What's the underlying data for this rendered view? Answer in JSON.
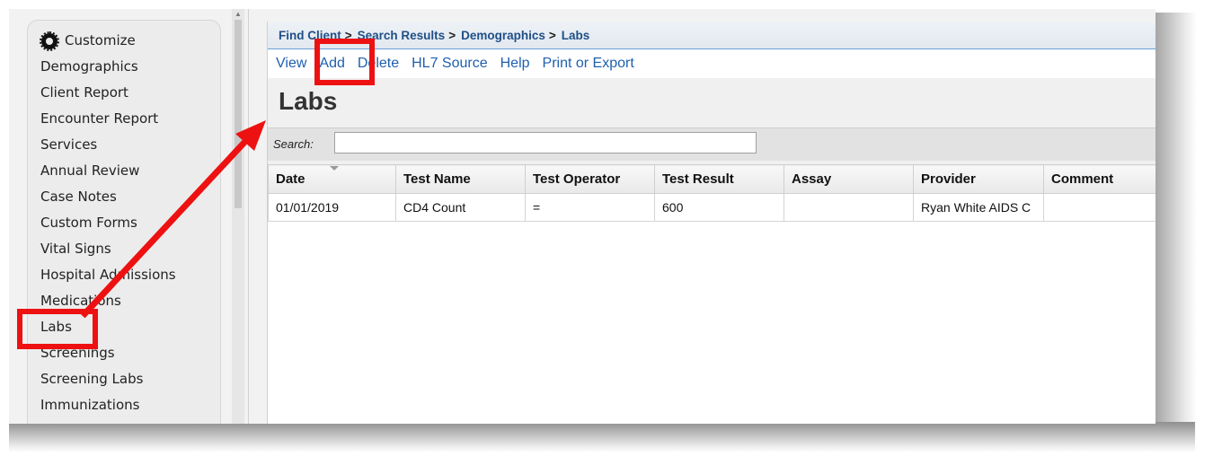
{
  "sidebar": {
    "items": [
      {
        "label": "Customize",
        "icon": "gear-icon"
      },
      {
        "label": "Demographics"
      },
      {
        "label": "Client Report"
      },
      {
        "label": "Encounter Report"
      },
      {
        "label": "Services"
      },
      {
        "label": "Annual Review"
      },
      {
        "label": "Case Notes"
      },
      {
        "label": "Custom Forms"
      },
      {
        "label": "Vital Signs"
      },
      {
        "label": "Hospital Admissions"
      },
      {
        "label": "Medications"
      },
      {
        "label": "Labs"
      },
      {
        "label": "Screenings"
      },
      {
        "label": "Screening Labs"
      },
      {
        "label": "Immunizations"
      }
    ]
  },
  "breadcrumb": {
    "items": [
      "Find Client",
      "Search Results",
      "Demographics",
      "Labs"
    ],
    "separator": ">"
  },
  "toolbar": {
    "links": [
      "View",
      "Add",
      "Delete",
      "HL7 Source",
      "Help",
      "Print or Export"
    ]
  },
  "page": {
    "title": "Labs"
  },
  "search": {
    "label": "Search:",
    "value": ""
  },
  "table": {
    "columns": [
      "Date",
      "Test Name",
      "Test Operator",
      "Test Result",
      "Assay",
      "Provider",
      "Comment"
    ],
    "rows": [
      [
        "01/01/2019",
        "CD4 Count",
        "=",
        "600",
        "",
        "Ryan White AIDS C",
        ""
      ]
    ]
  },
  "annotation": {
    "color": "#ee1111",
    "highlighted": [
      "Labs",
      "Add"
    ]
  },
  "colors": {
    "link": "#1f5fae",
    "breadcrumb": "#1f4f87",
    "accent_line": "#6aa0d8"
  }
}
